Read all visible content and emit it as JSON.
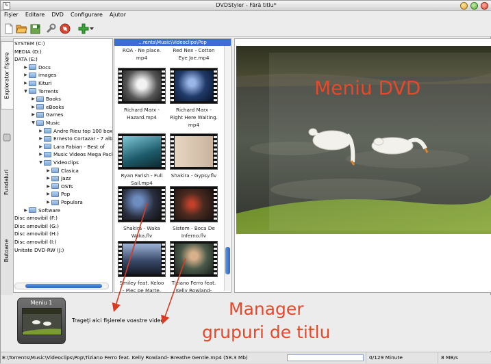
{
  "window": {
    "title": "DVDStyler - Fără titlu*"
  },
  "menubar": [
    "Fişier",
    "Editare",
    "DVD",
    "Configurare",
    "Ajutor"
  ],
  "toolbar": {
    "icons": [
      "new-file-icon",
      "open-folder-icon",
      "save-icon",
      "settings-wrench-icon",
      "burn-disc-icon",
      "add-icon",
      "dropdown-arrow-icon"
    ]
  },
  "side_tabs": {
    "file_explorer": "Explorator fişiere",
    "backgrounds": "Fundaluri",
    "buttons": "Butoane"
  },
  "tree": [
    {
      "label": "SYSTEM (C:)"
    },
    {
      "label": "MEDIA (D:)"
    },
    {
      "label": "DATA (E:)"
    },
    {
      "label": "Docs"
    },
    {
      "label": "images"
    },
    {
      "label": "Kituri"
    },
    {
      "label": "Torrents"
    },
    {
      "label": "Books"
    },
    {
      "label": "eBooks"
    },
    {
      "label": "Games"
    },
    {
      "label": "Music"
    },
    {
      "label": "Andre Rieu top 100 boxset"
    },
    {
      "label": "Ernesto Cortazar - 7 albums"
    },
    {
      "label": "Lara Fabian - Best of"
    },
    {
      "label": "Music Videos Mega Pack"
    },
    {
      "label": "Videoclips"
    },
    {
      "label": "Clasica"
    },
    {
      "label": "Jazz"
    },
    {
      "label": "OSTs"
    },
    {
      "label": "Pop"
    },
    {
      "label": "Populara"
    },
    {
      "label": "Software"
    },
    {
      "label": "Disc amovibil (F:)"
    },
    {
      "label": "Disc amovibil (G:)"
    },
    {
      "label": "Disc amovibil (H:)"
    },
    {
      "label": "Disc amovibil (I:)"
    },
    {
      "label": "Unitate DVD-RW (J:)"
    }
  ],
  "file_browser": {
    "path": "...rents\\Music\\Videoclips\\Pop",
    "files": [
      {
        "name": "ROA - Ne place.\nmp4"
      },
      {
        "name": "Red Nex - Cotton\nEye Joe.mp4"
      },
      {
        "name": "Richard Marx -\nHazard.mp4"
      },
      {
        "name": "Richard Marx -\nRight Here Waiting.\nmp4"
      },
      {
        "name": "Ryan Farish - Full\nSail.mp4"
      },
      {
        "name": "Shakira - Gypsy.flv"
      },
      {
        "name": "Shakira - Waka\nWaka.flv"
      },
      {
        "name": "Sistem - Boca De\nInferno.flv"
      },
      {
        "name": "Smiley feat. Keloo\n- Plec pe Marte.\nmp4"
      },
      {
        "name": "Tiziano Ferro feat.\nKelly Rowland-\nBreathe Gentle.\nmp4"
      }
    ]
  },
  "annotations": {
    "dvd_menu": "Meniu DVD",
    "manager_line1": "Manager",
    "manager_line2": "grupuri de titlu"
  },
  "titleset": {
    "menu_label": "Meniu 1",
    "drag_hint": "Trageţi aici fişierele voastre video"
  },
  "statusbar": {
    "file_path": "E:\\Torrents\\Music\\Videoclips\\Pop\\Tiziano Ferro feat. Kelly Rowland- Breathe Gentle.mp4 (58.3 Mb)",
    "progress_fraction": 0,
    "duration": "0/129 Minute",
    "rate": "8 MB/s"
  },
  "colors": {
    "annotation": "#e8472a",
    "selection": "#3a6fd0",
    "scroll_thumb": "#2f64c3"
  }
}
